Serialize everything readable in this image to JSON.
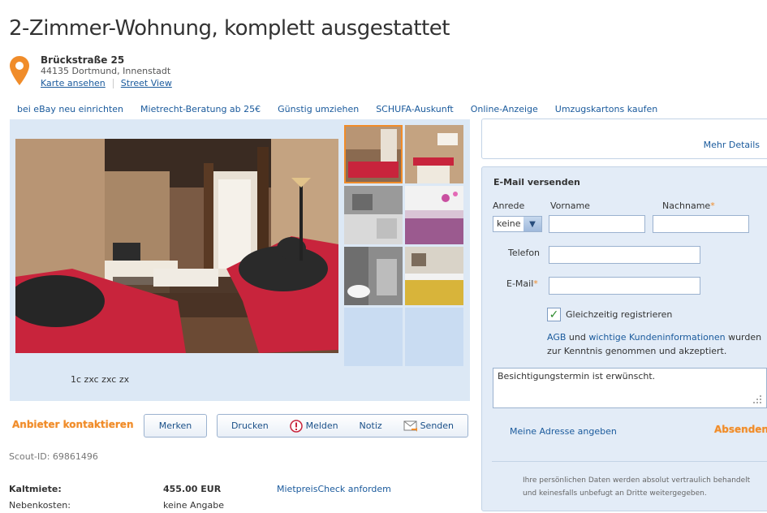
{
  "listing": {
    "title": "2-Zimmer-Wohnung, komplett ausgestattet",
    "street": "Brückstraße 25",
    "city": "44135 Dortmund, Innenstadt",
    "map_link": "Karte ansehen",
    "street_view_link": "Street View"
  },
  "services": [
    "bei eBay neu einrichten",
    "Mietrecht-Beratung ab 25€",
    "Günstig umziehen",
    "SCHUFA-Auskunft",
    "Online-Anzeige",
    "Umzugskartons kaufen"
  ],
  "gallery": {
    "caption": "1c zxc zxc zx"
  },
  "actions": {
    "contact": "Anbieter kontaktieren",
    "merken": "Merken",
    "drucken": "Drucken",
    "melden": "Melden",
    "notiz": "Notiz",
    "senden": "Senden"
  },
  "scout_id": "Scout-ID: 69861496",
  "costs": {
    "kaltmiete_label": "Kaltmiete:",
    "kaltmiete_value": "455.00 EUR",
    "mietpreis_link": "MietpreisCheck anfordem",
    "nebenkosten_label": "Nebenkosten:",
    "nebenkosten_value": "keine Angabe"
  },
  "side": {
    "mehr_details": "Mehr Details"
  },
  "form": {
    "title": "E-Mail versenden",
    "anrede_label": "Anrede",
    "anrede_value": "keine",
    "vorname_label": "Vorname",
    "nachname_label": "Nachname",
    "telefon_label": "Telefon",
    "email_label": "E-Mail",
    "register_label": "Gleichzeitig registrieren",
    "agb_link": "AGB",
    "agb_and": " und ",
    "kunden_link": "wichtige Kundeninformationen",
    "agb_rest1": " wurden",
    "agb_rest2": "zur Kenntnis genommen und akzeptiert.",
    "message": "Besichtigungstermin ist erwünscht.",
    "adresse_link": "Meine Adresse angeben",
    "submit": "Absenden",
    "privacy1": "Ihre persönlichen Daten werden absolut vertraulich behandelt",
    "privacy2": "und keinesfalls unbefugt an Dritte weitergegeben."
  },
  "colors": {
    "accent": "#f08c2a",
    "link": "#1a5a9c",
    "panel": "#dce8f5"
  },
  "icons": [
    "location-pin-icon",
    "warning-icon",
    "envelope-icon",
    "checkmark-icon",
    "chevron-down-icon"
  ]
}
